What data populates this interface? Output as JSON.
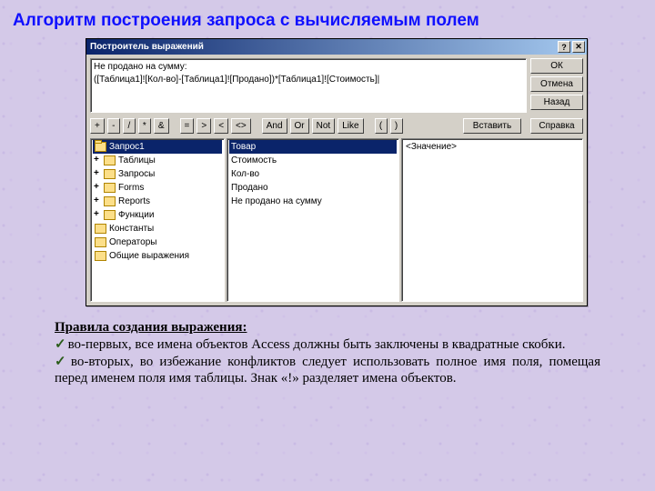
{
  "page_title": "Алгоритм построения запроса с вычисляемым полем",
  "window": {
    "title": "Построитель выражений",
    "help_btn": "?",
    "close_btn": "✕",
    "expression_line1": "Не продано на сумму:",
    "expression_line2": "([Таблица1]![Кол-во]-[Таблица1]![Продано])*[Таблица1]![Стоимость]|",
    "buttons": {
      "ok": "ОК",
      "cancel": "Отмена",
      "undo": "Назад",
      "help": "Справка",
      "insert": "Вставить"
    },
    "operators": [
      "+",
      "-",
      "/",
      "*",
      "&",
      "=",
      ">",
      "<",
      "<>",
      "And",
      "Or",
      "Not",
      "Like",
      "(",
      ")"
    ],
    "tree": {
      "items": [
        {
          "label": "Запрос1",
          "open": true,
          "plus": false,
          "selected": true
        },
        {
          "label": "Таблицы",
          "plus": true
        },
        {
          "label": "Запросы",
          "plus": true
        },
        {
          "label": "Forms",
          "plus": true
        },
        {
          "label": "Reports",
          "plus": true
        },
        {
          "label": "Функции",
          "plus": true
        },
        {
          "label": "Константы",
          "plus": false
        },
        {
          "label": "Операторы",
          "plus": false
        },
        {
          "label": "Общие выражения",
          "plus": false
        }
      ]
    },
    "fields": [
      "Товар",
      "Стоимость",
      "Кол-во",
      "Продано",
      "Не продано на сумму"
    ],
    "field_selected_index": 0,
    "values_placeholder": "<Значение>"
  },
  "rules": {
    "heading": "Правила создания выражения:",
    "item1": "во-первых, все имена объектов Access должны быть заключены в квадратные скобки.",
    "item2": "во-вторых, во избежание конфликтов следует использовать полное имя поля, помещая перед именем поля имя таблицы. Знак «!» разделяет имена объектов."
  }
}
